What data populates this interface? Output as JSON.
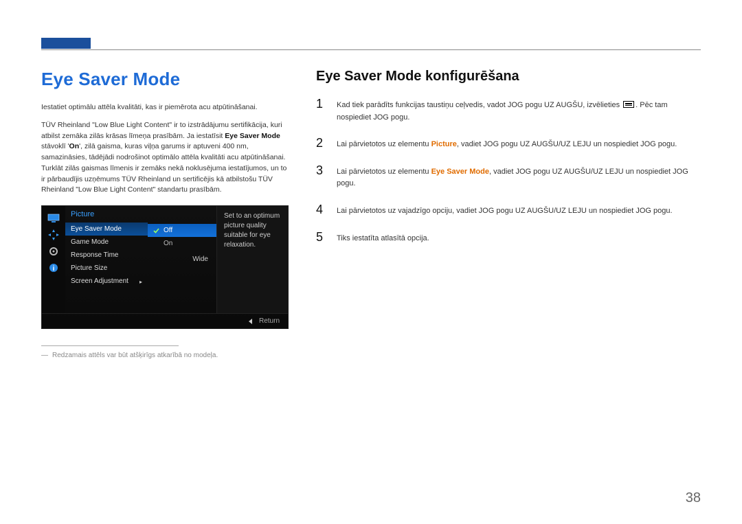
{
  "header": {
    "accent_color": "#1b4f9c"
  },
  "left": {
    "title": "Eye Saver Mode",
    "paragraph1": "Iestatiet optimālu attēla kvalitāti, kas ir piemērota acu atpūtināšanai.",
    "paragraph2_pre": "TÜV Rheinland \"Low Blue Light Content\" ir to izstrādājumu sertifikācija, kuri atbilst zemāka zilās krāsas līmeņa prasībām. Ja iestatīsit ",
    "paragraph2_bold": "Eye Saver Mode",
    "paragraph2_mid": " stāvoklī '",
    "paragraph2_on": "On",
    "paragraph2_post": "', zilā gaisma, kuras viļņa garums ir aptuveni 400 nm, samazināsies, tādējādi nodrošinot optimālo attēla kvalitāti acu atpūtināšanai. Turklāt zilās gaismas līmenis ir zemāks nekā noklusējuma iestatījumos, un to ir pārbaudījis uzņēmums TÜV Rheinland un sertificējis kā atbilstošu TÜV Rheinland \"Low Blue Light Content\" standartu prasībām.",
    "footnote": "Redzamais attēls var būt atšķirīgs atkarībā no modeļa."
  },
  "osd": {
    "menu_title": "Picture",
    "items": [
      "Eye Saver Mode",
      "Game Mode",
      "Response Time",
      "Picture Size",
      "Screen Adjustment"
    ],
    "options": [
      "Off",
      "On"
    ],
    "picture_size_value": "Wide",
    "description": "Set to an optimum picture quality suitable for eye relaxation.",
    "footer_return": "Return",
    "icons": [
      "monitor-icon",
      "arrows-icon",
      "gear-icon",
      "info-icon"
    ]
  },
  "right": {
    "title": "Eye Saver Mode konfigurēšana",
    "steps": [
      {
        "num": "1",
        "pre": "Kad tiek parādīts funkcijas taustiņu ceļvedis, vadot JOG pogu UZ AUGŠU, izvēlieties ",
        "has_glyph": true,
        "post": ". Pēc tam nospiediet JOG pogu."
      },
      {
        "num": "2",
        "pre": "Lai pārvietotos uz elementu ",
        "orange": "Picture",
        "post": ", vadiet JOG pogu UZ AUGŠU/UZ LEJU un nospiediet JOG pogu."
      },
      {
        "num": "3",
        "pre": "Lai pārvietotos uz elementu ",
        "orange": "Eye Saver Mode",
        "post": ", vadiet JOG pogu UZ AUGŠU/UZ LEJU un nospiediet JOG pogu."
      },
      {
        "num": "4",
        "pre": "Lai pārvietotos uz vajadzīgo opciju, vadiet JOG pogu UZ AUGŠU/UZ LEJU un nospiediet JOG pogu.",
        "post": ""
      },
      {
        "num": "5",
        "pre": "Tiks iestatīta atlasītā opcija.",
        "post": ""
      }
    ]
  },
  "page_number": "38"
}
